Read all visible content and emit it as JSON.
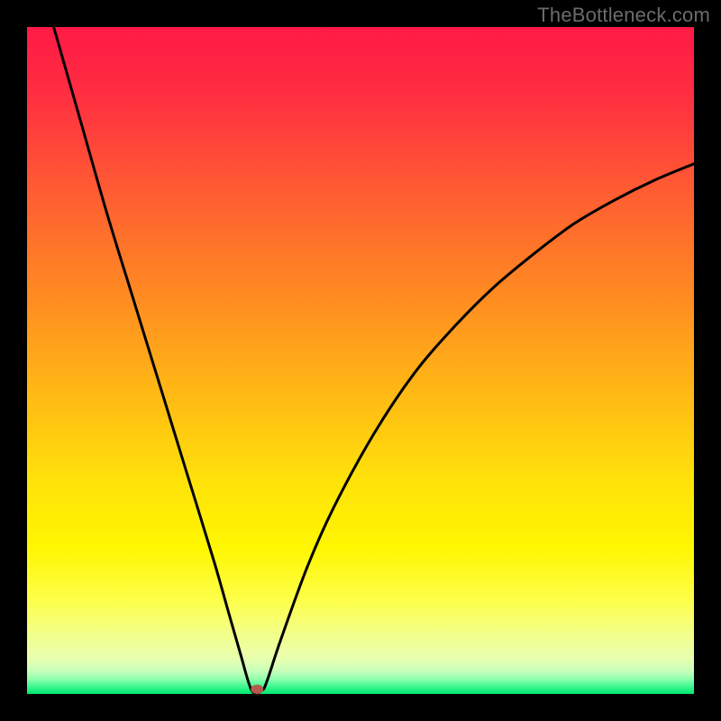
{
  "watermark": "TheBottleneck.com",
  "chart_data": {
    "type": "line",
    "title": "",
    "xlabel": "",
    "ylabel": "",
    "xlim": [
      0,
      100
    ],
    "ylim": [
      0,
      100
    ],
    "grid": false,
    "legend": false,
    "series": [
      {
        "name": "curve",
        "x": [
          4,
          8,
          12,
          16,
          20,
          24,
          28,
          30,
          32,
          33.7,
          35.2,
          36,
          38,
          42,
          46,
          52,
          58,
          64,
          70,
          76,
          82,
          88,
          94,
          100
        ],
        "y": [
          100,
          86,
          72,
          59,
          46,
          33,
          20,
          13,
          6,
          0.5,
          0.5,
          2,
          8,
          19,
          28,
          39,
          48,
          55,
          61,
          66,
          70.5,
          74,
          77,
          79.5
        ]
      }
    ],
    "minimum_marker": {
      "x": 34.5,
      "y": 0.7
    },
    "gradient_stops": [
      {
        "offset": 0.0,
        "color": "#ff1a46"
      },
      {
        "offset": 0.1,
        "color": "#ff2e41"
      },
      {
        "offset": 0.24,
        "color": "#ff5a33"
      },
      {
        "offset": 0.4,
        "color": "#ff8a22"
      },
      {
        "offset": 0.55,
        "color": "#ffb914"
      },
      {
        "offset": 0.68,
        "color": "#ffe20a"
      },
      {
        "offset": 0.78,
        "color": "#fff600"
      },
      {
        "offset": 0.86,
        "color": "#fdff4a"
      },
      {
        "offset": 0.91,
        "color": "#f2ff8a"
      },
      {
        "offset": 0.947,
        "color": "#e9ffb0"
      },
      {
        "offset": 0.965,
        "color": "#c9ffbb"
      },
      {
        "offset": 0.978,
        "color": "#8effad"
      },
      {
        "offset": 0.989,
        "color": "#3cf78f"
      },
      {
        "offset": 1.0,
        "color": "#00e76f"
      }
    ]
  }
}
